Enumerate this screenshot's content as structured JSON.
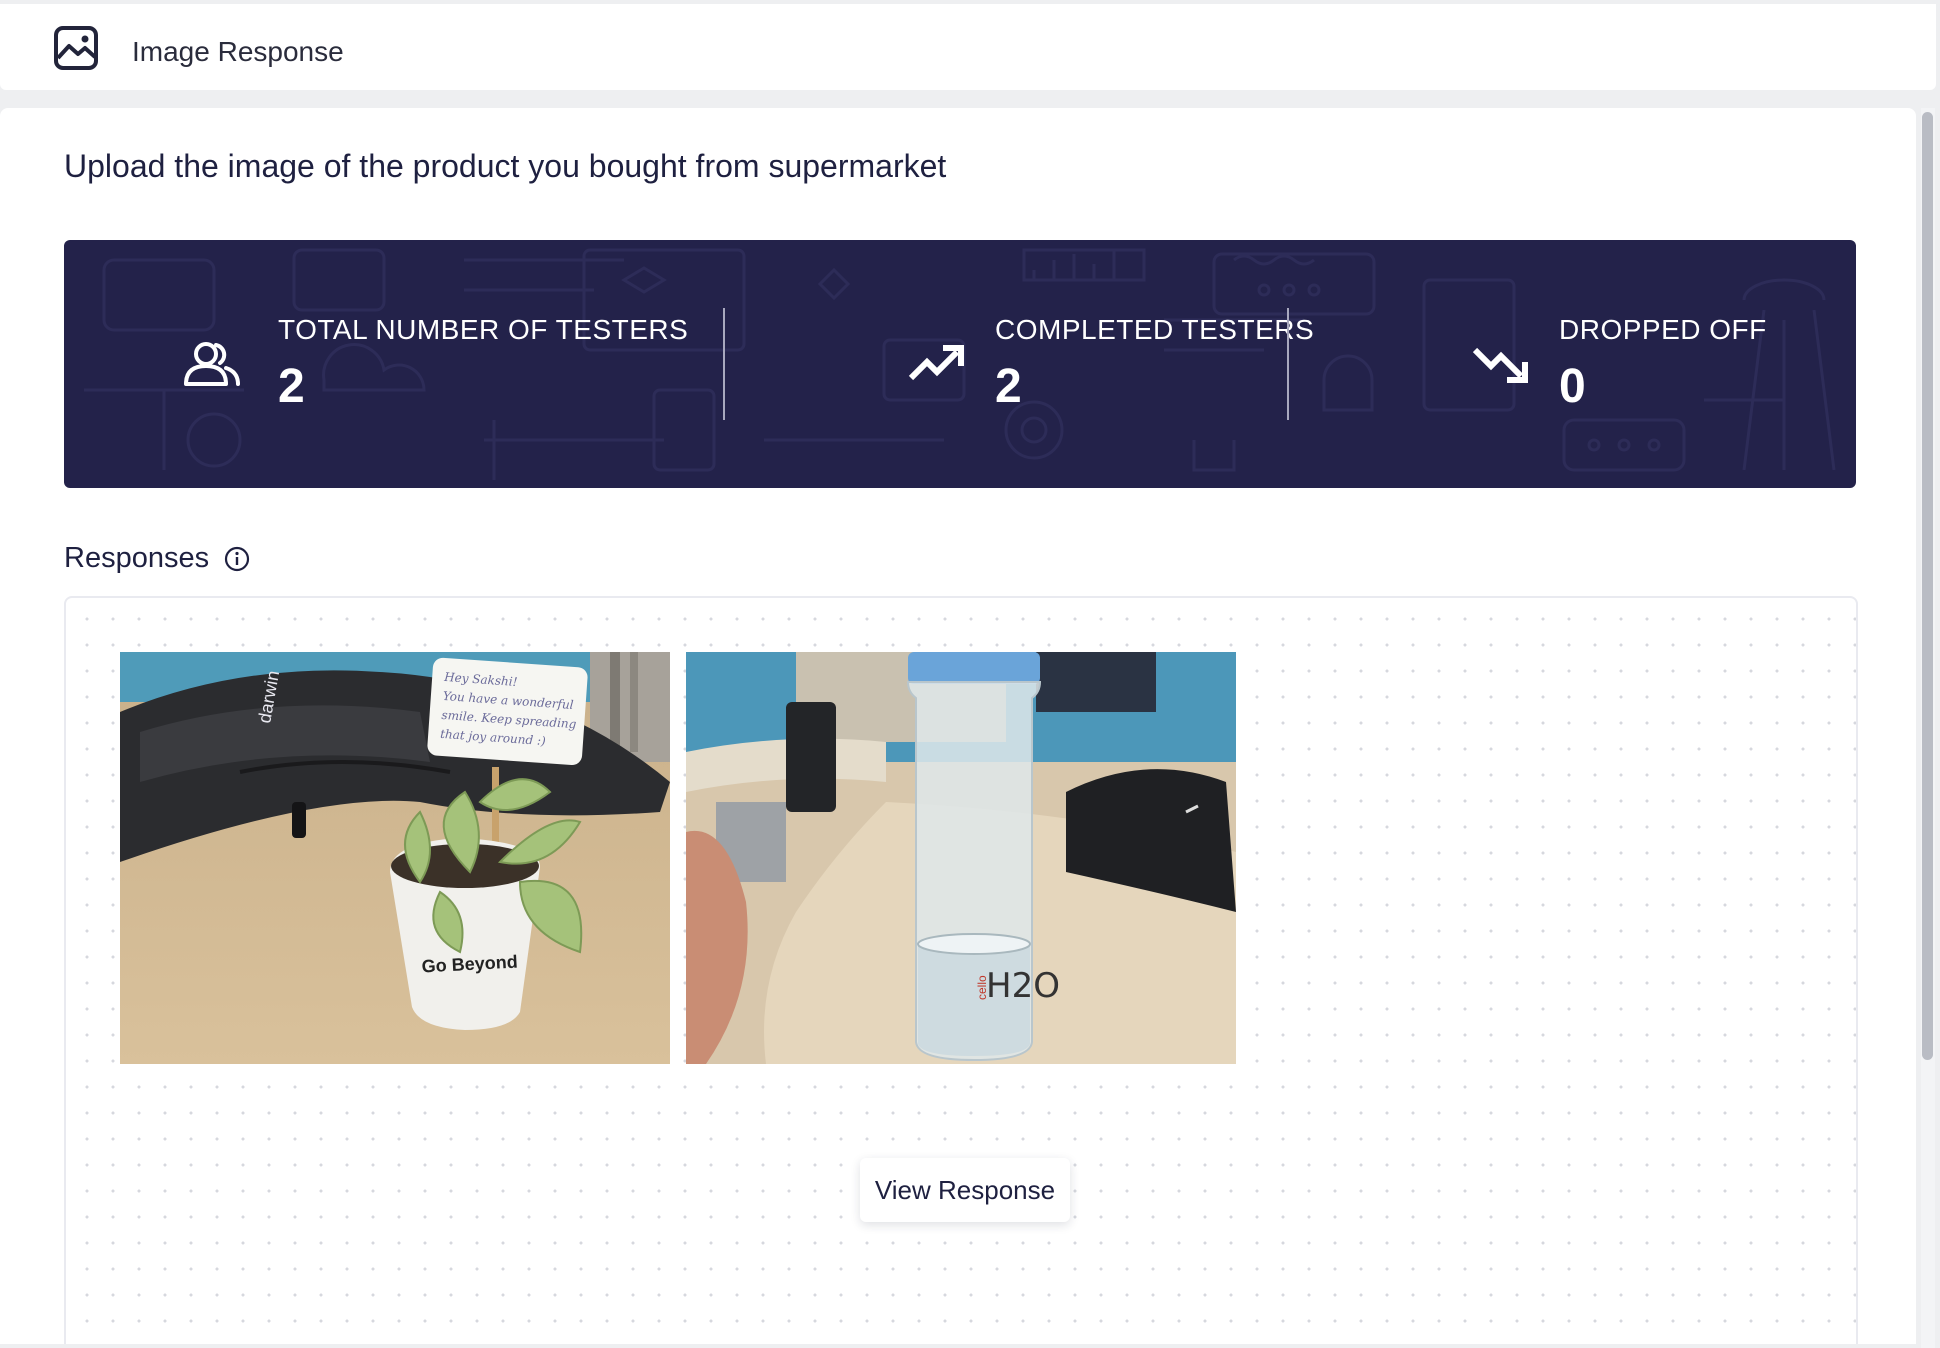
{
  "header": {
    "title": "Image Response",
    "icon": "image-icon"
  },
  "question": {
    "text": "Upload the image of the product you bought from supermarket"
  },
  "stats": {
    "background_color": "#23224a",
    "items": [
      {
        "label": "TOTAL NUMBER OF TESTERS",
        "value": "2",
        "icon": "users-icon"
      },
      {
        "label": "COMPLETED TESTERS",
        "value": "2",
        "icon": "trend-up-icon"
      },
      {
        "label": "DROPPED OFF",
        "value": "0",
        "icon": "trend-down-icon"
      }
    ]
  },
  "responses": {
    "title": "Responses",
    "info_icon": "info-icon",
    "images": [
      {
        "name": "plant-pot-photo",
        "card_text": [
          "Hey Sakshi!",
          "You have a wonderful",
          "smile. Keep spreading",
          "that joy around :)"
        ],
        "pot_text": "Go Beyond",
        "bag_text": "darwin"
      },
      {
        "name": "water-bottle-photo",
        "bottle_brand": "cello",
        "bottle_text": "H2O"
      }
    ],
    "view_button_label": "View Response"
  }
}
